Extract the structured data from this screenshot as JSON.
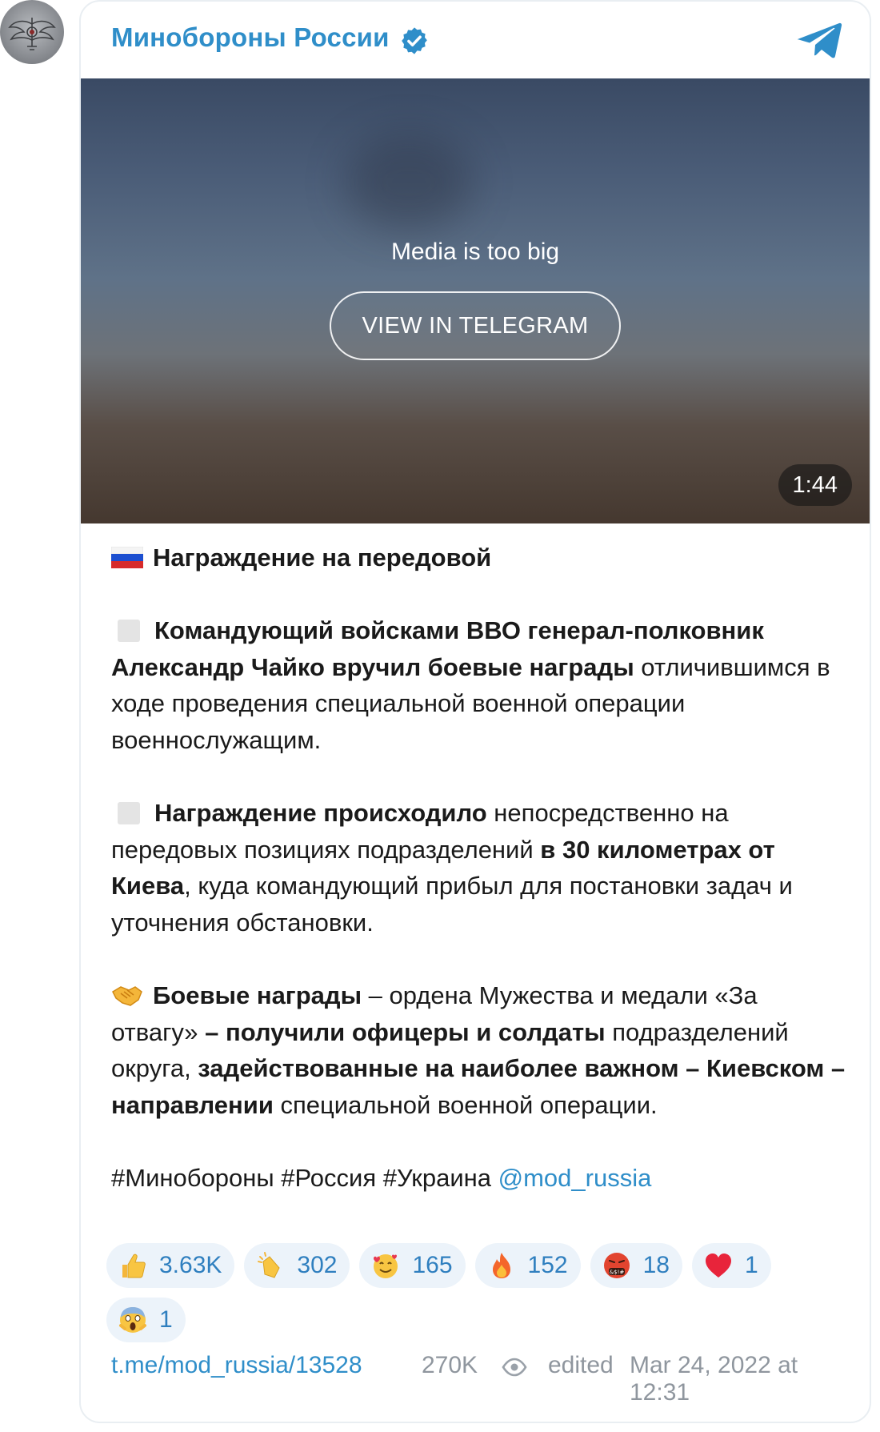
{
  "channel": {
    "name": "Минобороны России",
    "verified": true
  },
  "media": {
    "notice": "Media is too big",
    "view_button": "VIEW IN TELEGRAM",
    "duration": "1:44"
  },
  "post": {
    "title": "Награждение на передовой",
    "p1_bold": "Командующий войсками ВВО генерал-полковник Александр Чайко вручил боевые награды",
    "p1_rest": " отличившимся в ходе проведения специальной военной операции военнослужащим.",
    "p2_bold1": "Награждение происходило",
    "p2_text1": " непосредственно на передовых позициях подразделений ",
    "p2_bold2": "в 30 километрах от Киева",
    "p2_text2": ", куда командующий прибыл для постановки задач и уточнения обстановки.",
    "p3_bold1": "Боевые награды",
    "p3_text1": " – ордена Мужества и медали «За отвагу» ",
    "p3_bold2": "– получили офицеры и солдаты",
    "p3_text2": " подразделений округа, ",
    "p3_bold3": "задействованные на наиболее важном – Киевском – направлении",
    "p3_text3": " специальной военной операции.",
    "hashtags": "#Минобороны #Россия #Украина ",
    "mention": "@mod_russia"
  },
  "reactions": [
    {
      "emoji": "thumbs-up",
      "count": "3.63K"
    },
    {
      "emoji": "clapping-hands",
      "count": "302"
    },
    {
      "emoji": "smiling-face-with-hearts",
      "count": "165"
    },
    {
      "emoji": "fire",
      "count": "152"
    },
    {
      "emoji": "face-with-symbols-on-mouth",
      "count": "18"
    },
    {
      "emoji": "red-heart",
      "count": "1"
    },
    {
      "emoji": "face-screaming-in-fear",
      "count": "1"
    }
  ],
  "footer": {
    "link": "t.me/mod_russia/13528",
    "views": "270K",
    "edited": "edited",
    "date": "Mar 24, 2022 at 12:31"
  },
  "colors": {
    "accent": "#2f8ec9",
    "reaction_bg": "#ecf3fa",
    "meta_gray": "#8f969e"
  }
}
